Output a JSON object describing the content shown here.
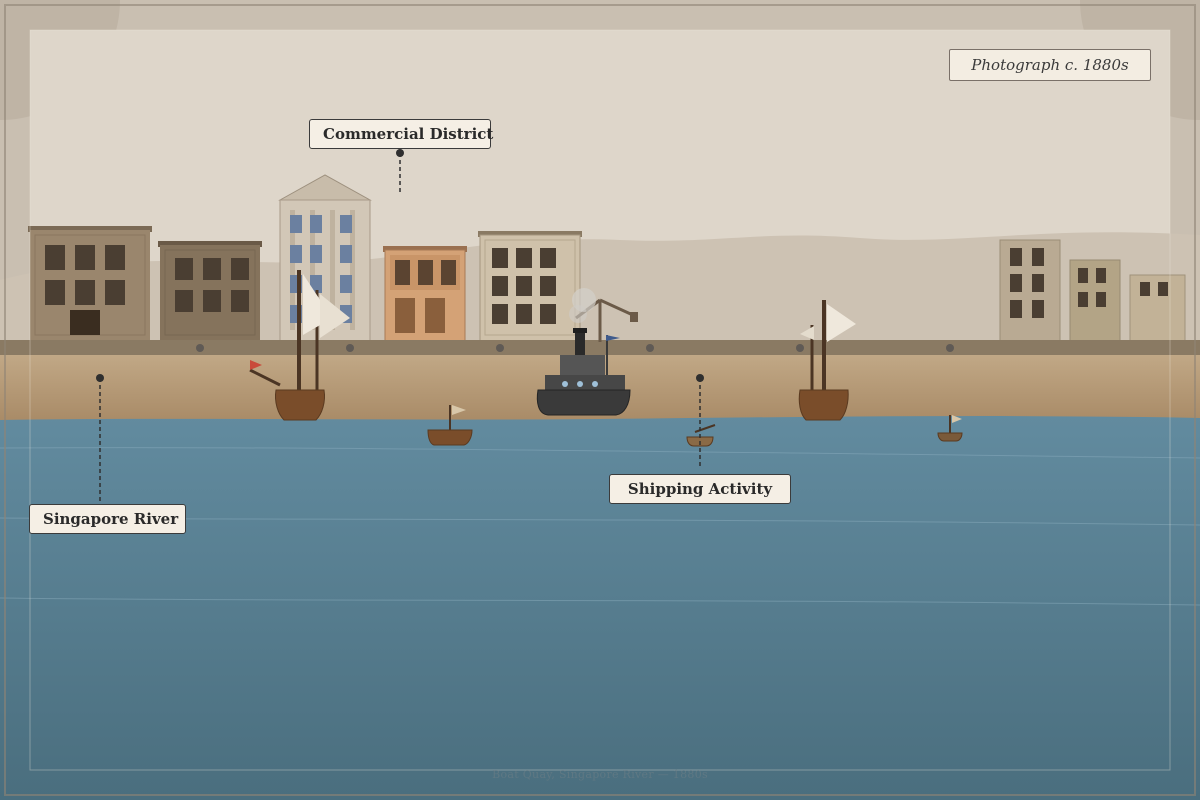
{
  "caption": "Photograph c. 1880s",
  "labels": {
    "commercial_district": "Commercial District",
    "singapore_river": "Singapore River",
    "shipping_activity": "Shipping Activity"
  },
  "credit": "Boat Quay, Singapore River — 1880s",
  "colors": {
    "sky": "#ded6ca",
    "hills": "#cdc2b3",
    "quay": "#8a7a63",
    "bank": "#b89f7c",
    "river_top": "#628a9e",
    "river_bottom": "#4a6e7e",
    "frame": "#c9bfb1"
  }
}
